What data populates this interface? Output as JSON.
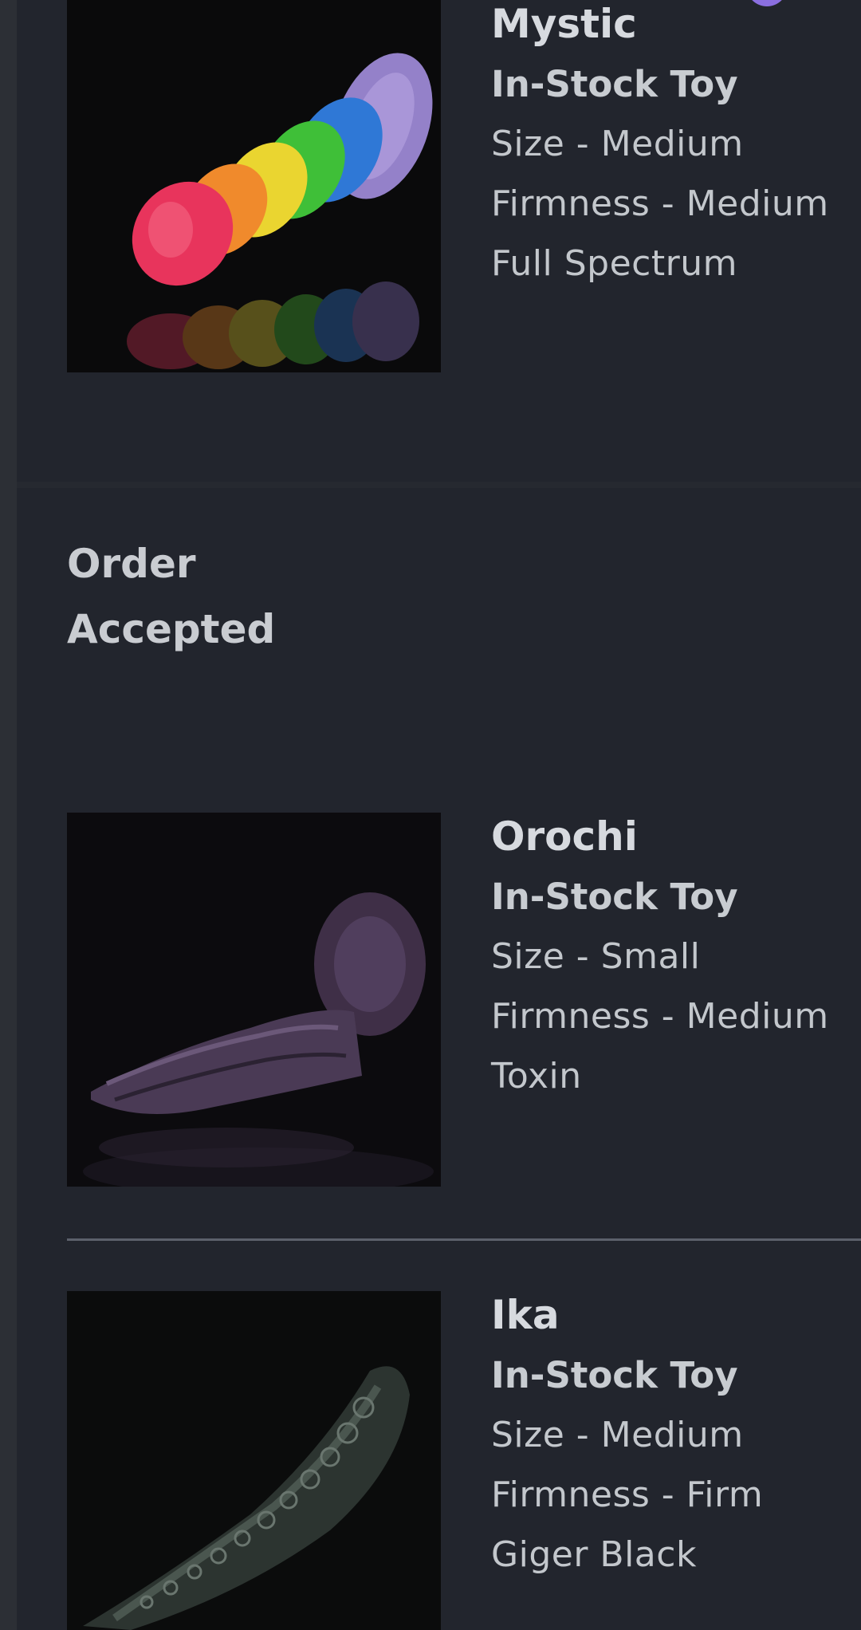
{
  "order_status": {
    "line1": "Order",
    "line2": "Accepted"
  },
  "products": [
    {
      "name": "Mystic",
      "type": "In-Stock Toy",
      "size": "Size - Medium",
      "firmness": "Firmness - Medium",
      "color": "Full Spectrum"
    },
    {
      "name": "Orochi",
      "type": "In-Stock Toy",
      "size": "Size - Small",
      "firmness": "Firmness - Medium",
      "color": "Toxin"
    },
    {
      "name": "Ika",
      "type": "In-Stock Toy",
      "size": "Size - Medium",
      "firmness": "Firmness - Firm",
      "color": "Giger Black"
    }
  ],
  "colors": {
    "background": "#2b2e34",
    "panel": "#22252d",
    "text": "#cfd2d7",
    "divider": "#5c616b",
    "avatar": "#8b6fe0"
  }
}
